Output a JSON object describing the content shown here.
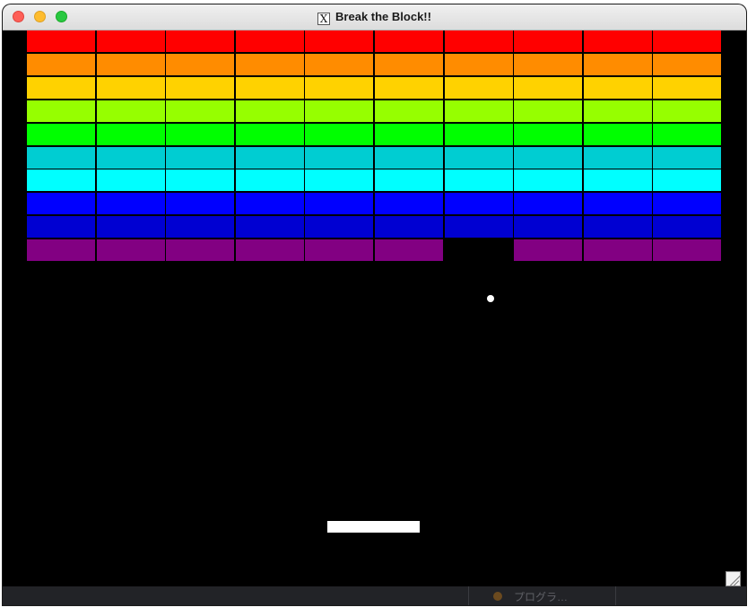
{
  "window": {
    "title": "Break the Block!!",
    "title_icon": "X",
    "controls": [
      "close",
      "minimize",
      "zoom"
    ]
  },
  "game": {
    "background": "#000000",
    "brick_rows": [
      {
        "color": "#ff0000",
        "bricks": [
          1,
          1,
          1,
          1,
          1,
          1,
          1,
          1,
          1,
          1
        ]
      },
      {
        "color": "#ff8c00",
        "bricks": [
          1,
          1,
          1,
          1,
          1,
          1,
          1,
          1,
          1,
          1
        ]
      },
      {
        "color": "#ffd200",
        "bricks": [
          1,
          1,
          1,
          1,
          1,
          1,
          1,
          1,
          1,
          1
        ]
      },
      {
        "color": "#96ff00",
        "bricks": [
          1,
          1,
          1,
          1,
          1,
          1,
          1,
          1,
          1,
          1
        ]
      },
      {
        "color": "#00ff00",
        "bricks": [
          1,
          1,
          1,
          1,
          1,
          1,
          1,
          1,
          1,
          1
        ]
      },
      {
        "color": "#00cdd2",
        "bricks": [
          1,
          1,
          1,
          1,
          1,
          1,
          1,
          1,
          1,
          1
        ]
      },
      {
        "color": "#00ffff",
        "bricks": [
          1,
          1,
          1,
          1,
          1,
          1,
          1,
          1,
          1,
          1
        ]
      },
      {
        "color": "#0000ff",
        "bricks": [
          1,
          1,
          1,
          1,
          1,
          1,
          1,
          1,
          1,
          1
        ]
      },
      {
        "color": "#0000d2",
        "bricks": [
          1,
          1,
          1,
          1,
          1,
          1,
          1,
          1,
          1,
          1
        ]
      },
      {
        "color": "#820082",
        "bricks": [
          1,
          1,
          1,
          1,
          1,
          1,
          0,
          1,
          1,
          1
        ]
      }
    ],
    "ball_color": "#ffffff",
    "paddle_color": "#ffffff"
  },
  "taskbar": {
    "label": "プログラ…"
  }
}
